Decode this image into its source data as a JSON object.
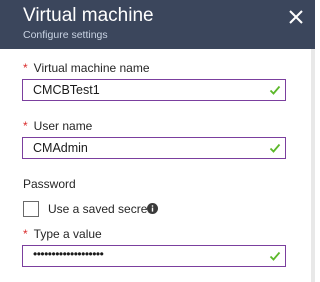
{
  "header": {
    "title": "Virtual machine",
    "subtitle": "Configure settings",
    "close_icon": "close-icon",
    "background_color": "#3b465c"
  },
  "form": {
    "required_marker": "*",
    "vm_name": {
      "label": "Virtual machine name",
      "value": "CMCBTest1",
      "valid": true
    },
    "user_name": {
      "label": "User name",
      "value": "CMAdmin",
      "valid": true
    },
    "password": {
      "section_label": "Password",
      "saved_secret_label": "Use a saved secret",
      "saved_secret_checked": false,
      "info_icon": "info-icon",
      "value_label": "Type a value",
      "value": "•••••••••••••••••••",
      "valid": true
    }
  },
  "colors": {
    "accent_border": "#7b3f9e",
    "required": "#d92c2c",
    "valid_check": "#5cb82a"
  }
}
